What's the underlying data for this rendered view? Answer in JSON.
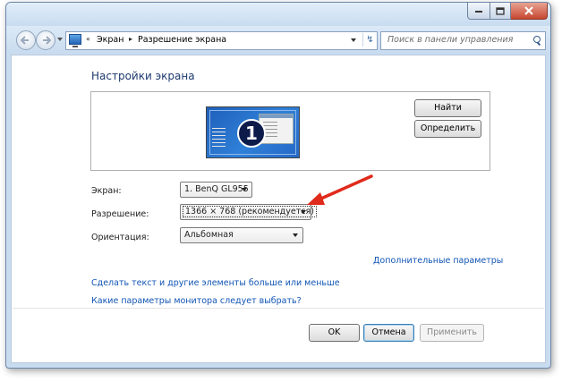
{
  "window": {
    "address_segments": [
      "Экран",
      "Разрешение экрана"
    ],
    "search_placeholder": "Поиск в панели управления"
  },
  "page": {
    "title": "Настройки экрана",
    "monitor_number": "1",
    "find_label": "Найти",
    "identify_label": "Определить"
  },
  "form": {
    "screen_label": "Экран:",
    "screen_value": "1. BenQ GL955",
    "resolution_label": "Разрешение:",
    "resolution_value": "1366 × 768 (рекомендуется)",
    "orientation_label": "Ориентация:",
    "orientation_value": "Альбомная"
  },
  "links": {
    "advanced": "Дополнительные параметры",
    "text_size": "Сделать текст и другие элементы больше или меньше",
    "monitor_params": "Какие параметры монитора следует выбрать?"
  },
  "footer": {
    "ok": "OK",
    "cancel": "Отмена",
    "apply": "Применить"
  },
  "colors": {
    "link": "#1155b4",
    "title": "#1e3a6e",
    "annotation_arrow": "#e02a1c"
  }
}
